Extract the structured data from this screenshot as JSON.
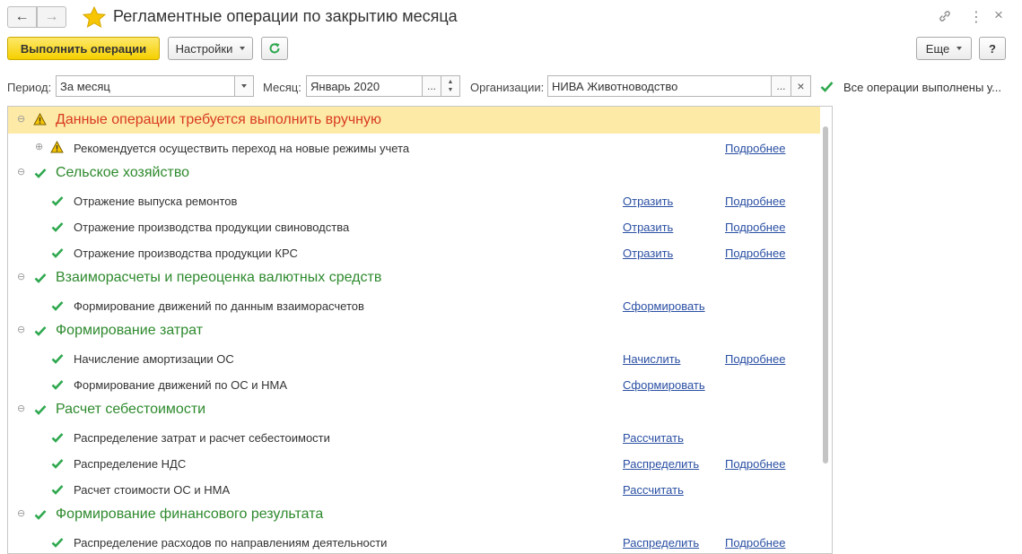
{
  "window": {
    "title": "Регламентные операции по закрытию месяца",
    "nav_back": "←",
    "nav_forward": "→",
    "link_icon": "⛓",
    "menu_icon": "⋮",
    "close_icon": "×"
  },
  "toolbar": {
    "execute_label": "Выполнить операции",
    "settings_label": "Настройки",
    "refresh_icon": "refresh-icon",
    "more_label": "Еще",
    "help_label": "?"
  },
  "filters": {
    "period_label": "Период:",
    "period_value": "За месяц",
    "month_label": "Месяц:",
    "month_value": "Январь 2020",
    "org_label": "Организации:",
    "org_value": "НИВА Животноводство",
    "dots": "...",
    "clear": "×",
    "status_text": "Все операции выполнены у..."
  },
  "colors": {
    "accent_yellow": "#f5cf00",
    "check_green": "#2fa84f",
    "group_green": "#2e8a2e",
    "warn_red": "#d83a1e",
    "link_blue": "#2a4fa3",
    "highlight": "#fdeaa7"
  },
  "groups": [
    {
      "title": "Данные операции требуется выполнить вручную",
      "status": "warning",
      "items": [
        {
          "text": "Рекомендуется осуществить переход на новые режимы учета",
          "action": "",
          "details": "Подробнее",
          "status": "warning",
          "expandable": true
        }
      ]
    },
    {
      "title": "Сельское хозяйство",
      "status": "ok",
      "items": [
        {
          "text": "Отражение выпуска ремонтов",
          "action": "Отразить",
          "details": "Подробнее",
          "status": "ok"
        },
        {
          "text": "Отражение производства продукции свиноводства",
          "action": "Отразить",
          "details": "Подробнее",
          "status": "ok"
        },
        {
          "text": "Отражение производства продукции КРС",
          "action": "Отразить",
          "details": "Подробнее",
          "status": "ok"
        }
      ]
    },
    {
      "title": "Взаиморасчеты и переоценка валютных средств",
      "status": "ok",
      "items": [
        {
          "text": "Формирование движений по данным взаиморасчетов",
          "action": "Сформировать",
          "details": "",
          "status": "ok"
        }
      ]
    },
    {
      "title": "Формирование затрат",
      "status": "ok",
      "items": [
        {
          "text": "Начисление амортизации ОС",
          "action": "Начислить",
          "details": "Подробнее",
          "status": "ok"
        },
        {
          "text": "Формирование движений по ОС и НМА",
          "action": "Сформировать",
          "details": "",
          "status": "ok"
        }
      ]
    },
    {
      "title": "Расчет себестоимости",
      "status": "ok",
      "items": [
        {
          "text": "Распределение затрат и расчет себестоимости",
          "action": "Рассчитать",
          "details": "",
          "status": "ok"
        },
        {
          "text": "Распределение НДС",
          "action": "Распределить",
          "details": "Подробнее",
          "status": "ok"
        },
        {
          "text": "Расчет стоимости ОС и НМА",
          "action": "Рассчитать",
          "details": "",
          "status": "ok"
        }
      ]
    },
    {
      "title": "Формирование финансового результата",
      "status": "ok",
      "items": [
        {
          "text": "Распределение расходов по направлениям деятельности",
          "action": "Распределить",
          "details": "Подробнее",
          "status": "ok"
        }
      ]
    }
  ]
}
